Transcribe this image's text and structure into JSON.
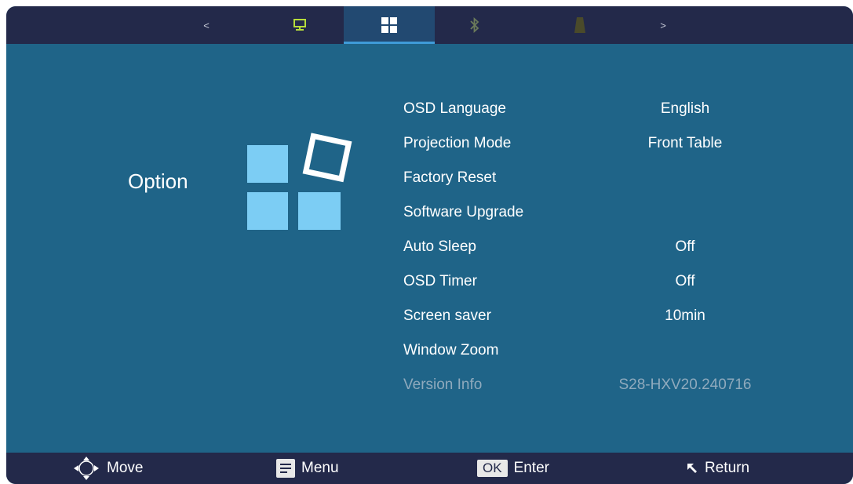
{
  "top_tabs": {
    "left_arrow": "<",
    "right_arrow": ">",
    "tabs": [
      {
        "icon": "monitor-icon"
      },
      {
        "icon": "option-grid-icon",
        "active": true
      },
      {
        "icon": "bluetooth-icon"
      },
      {
        "icon": "keystone-icon"
      }
    ]
  },
  "section": {
    "title": "Option",
    "icon": "option-large-icon"
  },
  "menu": [
    {
      "label": "OSD Language",
      "value": "English"
    },
    {
      "label": "Projection Mode",
      "value": "Front Table"
    },
    {
      "label": "Factory Reset",
      "value": ""
    },
    {
      "label": "Software Upgrade",
      "value": ""
    },
    {
      "label": "Auto Sleep",
      "value": "Off"
    },
    {
      "label": "OSD Timer",
      "value": "Off"
    },
    {
      "label": "Screen saver",
      "value": "10min"
    },
    {
      "label": "Window Zoom",
      "value": ""
    },
    {
      "label": "Version Info",
      "value": "S28-HXV20.240716",
      "disabled": true
    }
  ],
  "footer": {
    "move": "Move",
    "menu": "Menu",
    "ok_key": "OK",
    "enter": "Enter",
    "return": "Return"
  },
  "colors": {
    "panel": "#1f6488",
    "bar": "#23294a",
    "active_tab": "#224971",
    "accent": "#3f9bd8",
    "icon_light": "#7ccdf4",
    "keystone_icon": "#4a4a2a"
  }
}
